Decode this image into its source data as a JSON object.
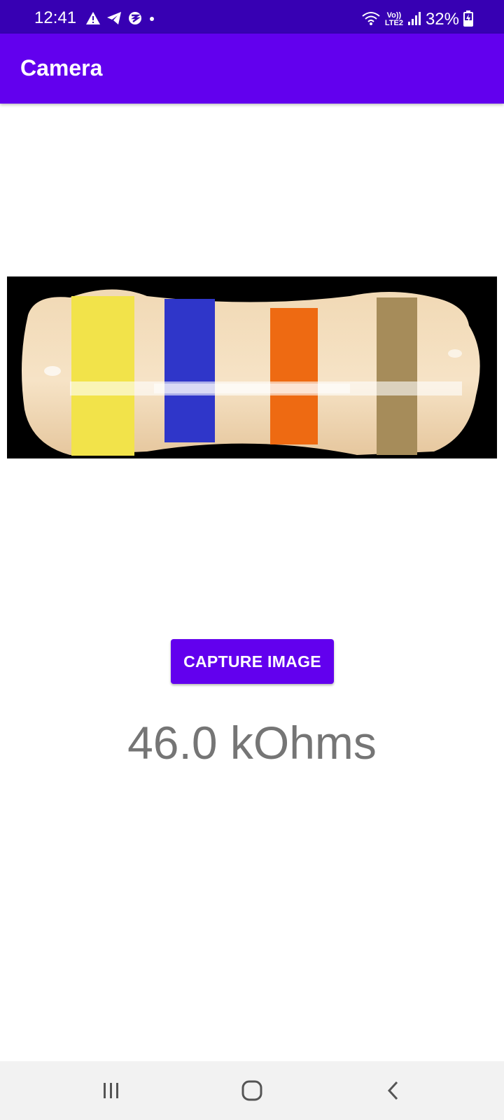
{
  "status_bar": {
    "time": "12:41",
    "battery": "32%",
    "left_icons": [
      "alert-icon",
      "telegram-icon",
      "app-icon",
      "dot-icon"
    ],
    "right_icons": [
      "wifi-icon",
      "volte-lte2-icon",
      "signal-icon",
      "battery-charging-icon"
    ],
    "volte_label": "Vo))",
    "lte_label": "LTE2"
  },
  "app_bar": {
    "title": "Camera",
    "color": "#6200ee"
  },
  "image": {
    "subject": "resistor",
    "bands": [
      "#f2e34a",
      "#2f36c9",
      "#ee6a12",
      "#a68c5a"
    ]
  },
  "capture_button": {
    "label": "CAPTURE IMAGE"
  },
  "result": {
    "text": "46.0 kOhms"
  },
  "nav_bar": {
    "buttons": [
      "recents-icon",
      "home-icon",
      "back-icon"
    ]
  }
}
